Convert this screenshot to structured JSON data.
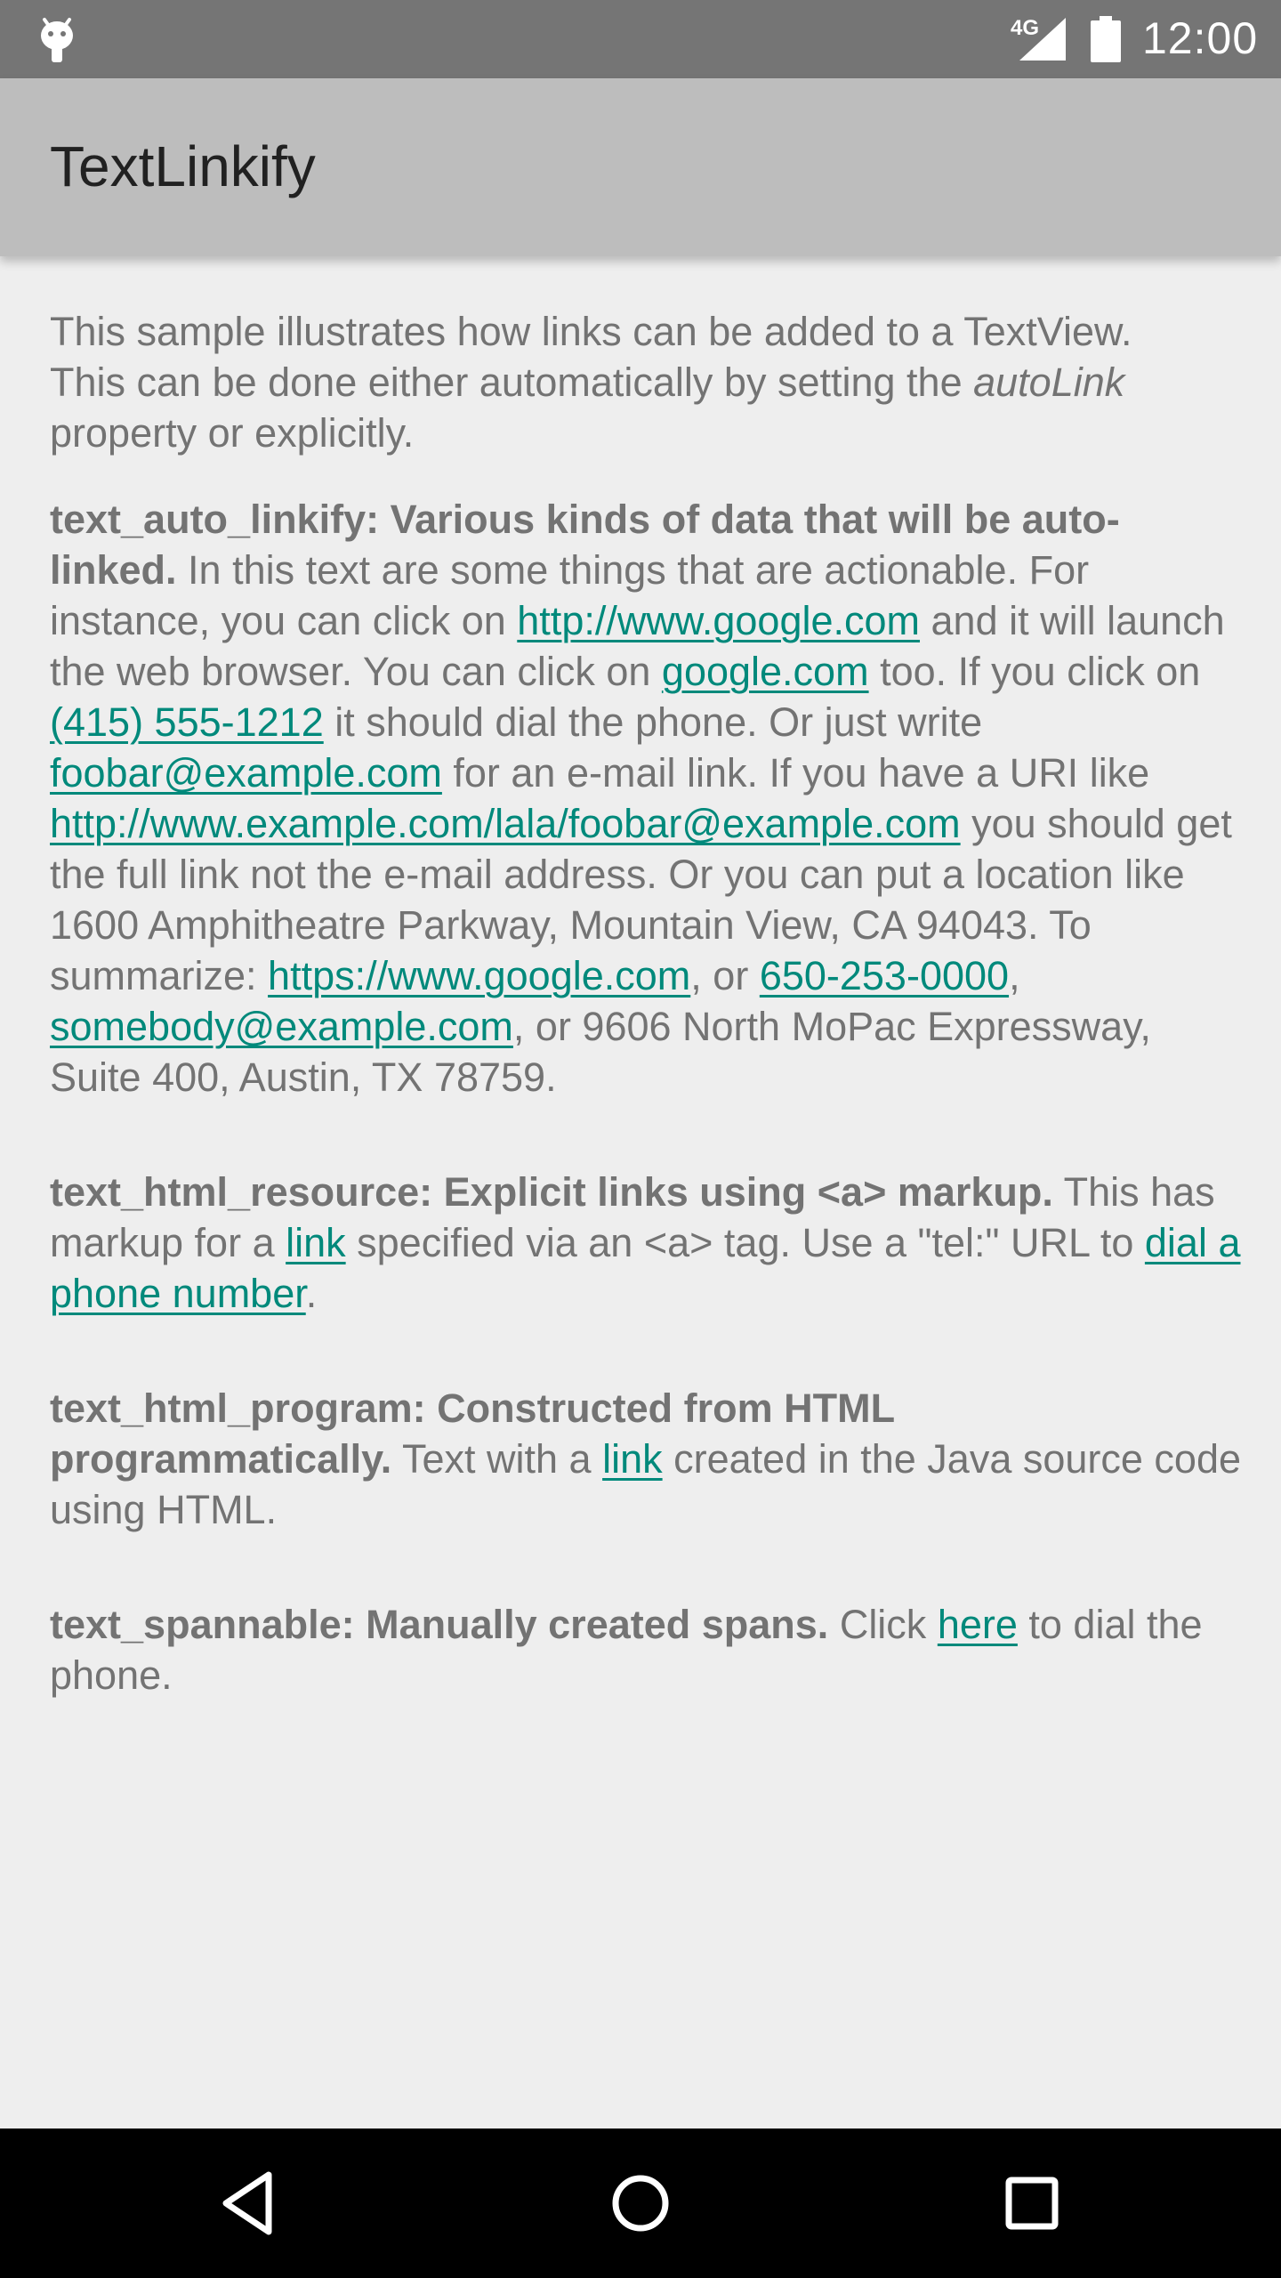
{
  "status_bar": {
    "network": "4G",
    "time": "12:00",
    "icons": [
      "android-debug-icon",
      "signal-icon",
      "battery-icon"
    ]
  },
  "app_bar": {
    "title": "TextLinkify"
  },
  "intro": {
    "line1": "This sample illustrates how links can be added to a TextView.",
    "line2_before": "This can be done either automatically by setting the ",
    "line2_em": "autoLink",
    "line2_after": " property or explicitly."
  },
  "auto_linkify": {
    "heading": "text_auto_linkify: Various kinds of data that will be auto-linked.",
    "t1": " In this text are some things that are actionable. For instance, you can click on ",
    "link1": "http://www.google.com",
    "t2": " and it will launch the web browser. You can click on ",
    "link2": "google.com",
    "t3": " too. If you click on ",
    "link3": "(415) 555-1212",
    "t4": " it should dial the phone. Or just write ",
    "link4": "foobar@example.com",
    "t5": " for an e-mail link. If you have a URI like ",
    "link5": "http://www.example.com/lala/foobar@example.com",
    "t6": " you should get the full link not the e-mail address. Or you can put a location like 1600 Amphitheatre Parkway, Mountain View, CA 94043. To summarize: ",
    "link6": "https://www.google.com",
    "t7": ", or ",
    "link7": "650-253-0000",
    "t8": ", ",
    "link8": "somebody@example.com",
    "t9": ", or 9606 North MoPac Expressway, Suite 400, Austin, TX 78759."
  },
  "html_resource": {
    "heading": "text_html_resource: Explicit links using <a> markup.",
    "t1": " This has markup for a ",
    "link1": "link",
    "t2": " specified via an <a> tag. Use a \"tel:\" URL to ",
    "link2": "dial a phone number",
    "t3": "."
  },
  "html_program": {
    "heading": "text_html_program: Constructed from HTML programmatically.",
    "t1": " Text with a ",
    "link1": "link",
    "t2": " created in the Java source code using HTML."
  },
  "spannable": {
    "heading": "text_spannable: Manually created spans.",
    "t1": " Click ",
    "link1": "here",
    "t2": " to dial the phone."
  },
  "nav_bar": {
    "icons": [
      "back-icon",
      "home-icon",
      "recents-icon"
    ]
  },
  "colors": {
    "status_bar": "#757575",
    "app_bar": "#bdbdbd",
    "background": "#eeeeee",
    "text": "#737373",
    "link": "#00897b",
    "nav_bar": "#000000"
  }
}
